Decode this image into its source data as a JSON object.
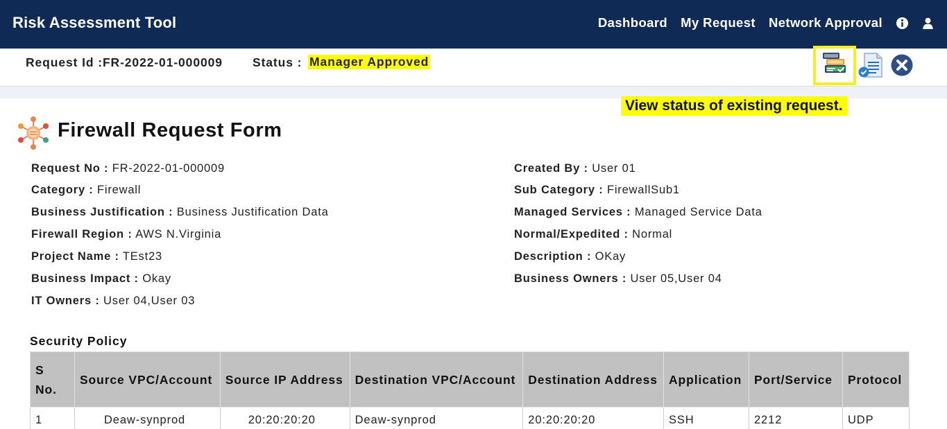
{
  "app": {
    "title": "Risk Assessment Tool"
  },
  "nav": {
    "links": [
      "Dashboard",
      "My Request",
      "Network Approval"
    ],
    "icons": [
      "info-icon",
      "user-icon"
    ]
  },
  "request_bar": {
    "request_id": "Request Id :FR-2022-01-000009",
    "status_label": "Status :",
    "status_value": "Manager Approved",
    "status_highlight_color": "#ffff00",
    "actions": [
      "view-status-icon",
      "document-check-icon",
      "close-icon"
    ]
  },
  "tooltip": {
    "text": "View status of existing request."
  },
  "form": {
    "title": "Firewall Request Form",
    "left_fields": [
      {
        "label": "Request No :",
        "value": "FR-2022-01-000009"
      },
      {
        "label": "Category :",
        "value": "Firewall"
      },
      {
        "label": "Business Justification :",
        "value": "Business Justification Data"
      },
      {
        "label": "Firewall Region :",
        "value": "AWS N.Virginia"
      },
      {
        "label": "Project Name :",
        "value": "TEst23"
      },
      {
        "label": "Business Impact :",
        "value": "Okay"
      },
      {
        "label": "IT Owners :",
        "value": "User 04,User 03"
      }
    ],
    "right_fields": [
      {
        "label": "Created By :",
        "value": "User 01"
      },
      {
        "label": "Sub Category :",
        "value": "FirewallSub1"
      },
      {
        "label": "Managed Services :",
        "value": "Managed Service Data"
      },
      {
        "label": "Normal/Expedited :",
        "value": "Normal"
      },
      {
        "label": "Description :",
        "value": "OKay"
      },
      {
        "label": "Business Owners :",
        "value": "User 05,User 04"
      }
    ]
  },
  "security_policy": {
    "title": "Security Policy",
    "columns": [
      "S No.",
      "Source VPC/Account",
      "Source IP Address",
      "Destination VPC/Account",
      "Destination Address",
      "Application",
      "Port/Service",
      "Protocol"
    ],
    "rows": [
      [
        "1",
        "Deaw-synprod",
        "20:20:20:20",
        "Deaw-synprod",
        "20:20:20:20",
        "SSH",
        "2212",
        "UDP"
      ]
    ]
  },
  "colors": {
    "topbar": "#0f2a55",
    "highlight": "#ffff00",
    "table_header": "#c1c1c1",
    "close_button": "#2d4f86"
  }
}
